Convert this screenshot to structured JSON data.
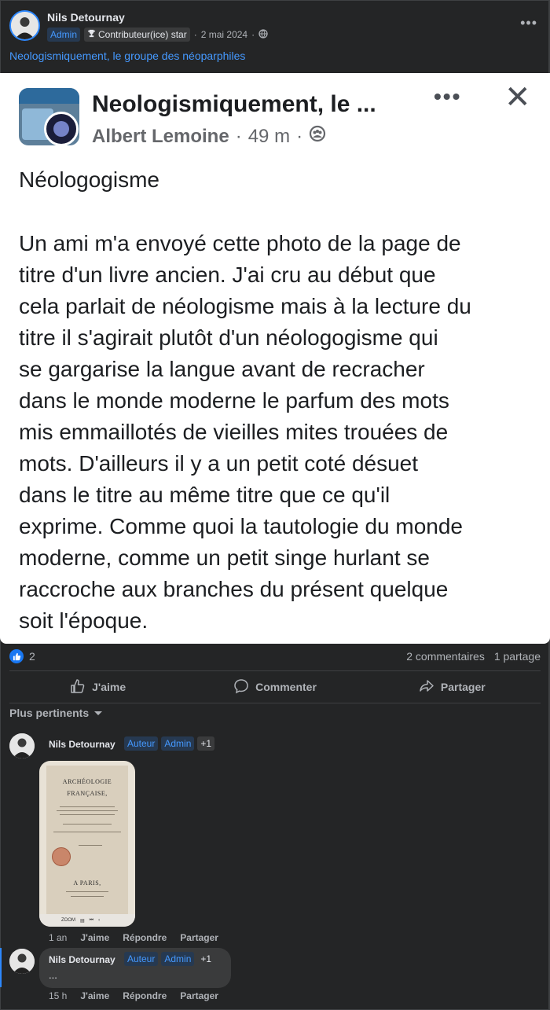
{
  "post": {
    "author": "Nils Detournay",
    "badge_admin": "Admin",
    "badge_contrib": "Contributeur(ice) star",
    "date": "2 mai 2024",
    "separator": "·",
    "group": "Neologismiquement, le groupe des néoparphiles",
    "more": "•••"
  },
  "shared": {
    "title": "Neologismiquement, le ...",
    "author": "Albert Lemoine",
    "time": "49 m",
    "separator": "·",
    "more": "•••",
    "close": "✕",
    "heading": "Néologogisme",
    "lines": [
      "Un ami m'a envoyé cette photo de la page de",
      "titre d'un livre ancien. J'ai cru au début que",
      "cela parlait de néologisme mais à la lecture du",
      "titre il s'agirait plutôt d'un néologogisme qui",
      "se gargarise la langue avant de recracher",
      "dans le monde moderne le parfum des mots",
      "mis emmaillotés de vieilles mites trouées de",
      "mots. D'ailleurs il y a un petit coté désuet",
      "dans le titre au même titre que ce qu'il",
      "exprime. Comme quoi la tautologie du monde",
      "moderne, comme un petit singe hurlant se",
      "raccroche aux branches du présent quelque",
      "soit l'époque."
    ]
  },
  "reactions": {
    "count": "2",
    "comments": "2 commentaires",
    "shares": "1 partage"
  },
  "actions": {
    "like": "J'aime",
    "comment": "Commenter",
    "share": "Partager"
  },
  "sort": {
    "label": "Plus pertinents"
  },
  "comments": [
    {
      "author": "Nils Detournay",
      "badge_author": "Auteur",
      "badge_admin": "Admin",
      "badge_more": "+1",
      "time": "1 an",
      "like": "J'aime",
      "reply": "Répondre",
      "share": "Partager",
      "photo": {
        "title_line1": "ARCHÉOLOGIE",
        "title_line2": "FRANÇAISE,",
        "footer_line1": "A PARIS,",
        "toolbar_zoom": "ZOOM"
      }
    },
    {
      "author": "Nils Detournay",
      "badge_author": "Auteur",
      "badge_admin": "Admin",
      "badge_more": "+1",
      "text": "...",
      "time": "15 h",
      "like": "J'aime",
      "reply": "Répondre",
      "share": "Partager"
    }
  ]
}
